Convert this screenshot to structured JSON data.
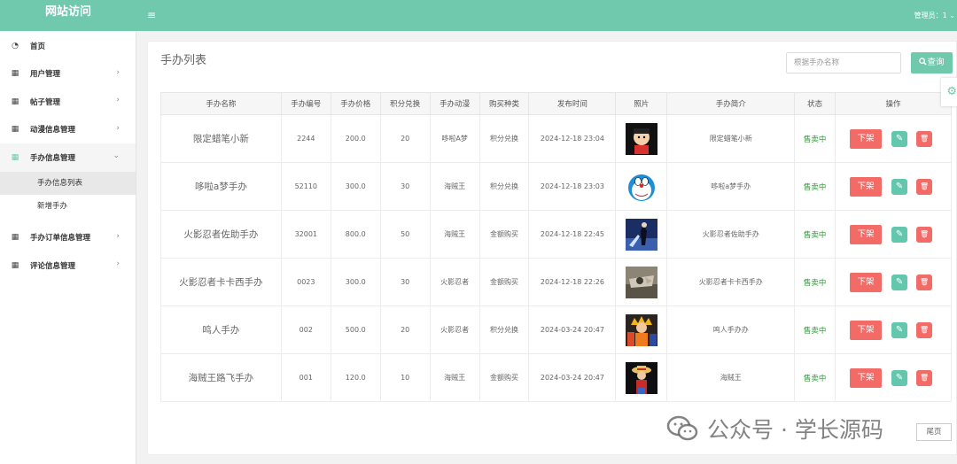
{
  "header": {
    "site_name": "网站访问",
    "menu_icon": "≡",
    "admin_label": "管理员：1 ⌄"
  },
  "sidebar": {
    "items": [
      {
        "name": "nav-home",
        "icon": "dashboard-icon",
        "glyph": "◔",
        "label": "首页",
        "arrow": ""
      },
      {
        "name": "nav-users",
        "icon": "table-icon",
        "glyph": "▦",
        "label": "用户管理",
        "arrow": "›"
      },
      {
        "name": "nav-posts",
        "icon": "table-icon",
        "glyph": "▦",
        "label": "帖子管理",
        "arrow": "›"
      },
      {
        "name": "nav-anime",
        "icon": "table-icon",
        "glyph": "▦",
        "label": "动漫信息管理",
        "arrow": "›"
      },
      {
        "name": "nav-figures",
        "icon": "table-icon",
        "glyph": "▦",
        "label": "手办信息管理",
        "arrow": "⌄"
      }
    ],
    "sub_items": [
      {
        "label": "手办信息列表"
      },
      {
        "label": "新增手办"
      }
    ],
    "items_after": [
      {
        "name": "nav-orders",
        "icon": "table-icon",
        "glyph": "▦",
        "label": "手办订单信息管理",
        "arrow": "›"
      },
      {
        "name": "nav-comments",
        "icon": "table-icon",
        "glyph": "▦",
        "label": "评论信息管理",
        "arrow": "›"
      }
    ]
  },
  "panel": {
    "title": "手办列表",
    "search_placeholder": "根据手办名称",
    "query_label": "查询",
    "query_icon": "search-icon"
  },
  "table": {
    "headers": [
      "手办名称",
      "手办编号",
      "手办价格",
      "积分兑换",
      "手办动漫",
      "购买种类",
      "发布时间",
      "照片",
      "手办简介",
      "状态",
      "操作"
    ],
    "rows": [
      {
        "name": "限定蜡笔小新",
        "code": "2244",
        "price": "200.0",
        "points": "20",
        "anime": "哆啦A梦",
        "type": "积分兑换",
        "date": "2024-12-18 23:04",
        "photo": "crayon-shin-chan",
        "intro": "限定蜡笔小新",
        "status": "售卖中",
        "off_label": "下架"
      },
      {
        "name": "哆啦a梦手办",
        "code": "52110",
        "price": "300.0",
        "points": "30",
        "anime": "海贼王",
        "type": "积分兑换",
        "date": "2024-12-18 23:03",
        "photo": "doraemon",
        "intro": "哆啦a梦手办",
        "status": "售卖中",
        "off_label": "下架"
      },
      {
        "name": "火影忍者佐助手办",
        "code": "32001",
        "price": "800.0",
        "points": "50",
        "anime": "海贼王",
        "type": "金额购买",
        "date": "2024-12-18 22:45",
        "photo": "sasuke",
        "intro": "火影忍者佐助手办",
        "status": "售卖中",
        "off_label": "下架"
      },
      {
        "name": "火影忍者卡卡西手办",
        "code": "0023",
        "price": "300.0",
        "points": "30",
        "anime": "火影忍者",
        "type": "金额购买",
        "date": "2024-12-18 22:26",
        "photo": "kakashi",
        "intro": "火影忍者卡卡西手办",
        "status": "售卖中",
        "off_label": "下架"
      },
      {
        "name": "鸣人手办",
        "code": "002",
        "price": "500.0",
        "points": "20",
        "anime": "火影忍者",
        "type": "积分兑换",
        "date": "2024-03-24 20:47",
        "photo": "naruto",
        "intro": "鸣人手办办",
        "status": "售卖中",
        "off_label": "下架"
      },
      {
        "name": "海贼王路飞手办",
        "code": "001",
        "price": "120.0",
        "points": "10",
        "anime": "海贼王",
        "type": "金额购买",
        "date": "2024-03-24 20:47",
        "photo": "luffy",
        "intro": "海贼王",
        "status": "售卖中",
        "off_label": "下架"
      }
    ]
  },
  "pager": {
    "last_label": "尾页"
  },
  "watermark": {
    "text": "公众号 · 学长源码"
  },
  "colors": {
    "accent": "#70c9ad",
    "danger": "#f36b67",
    "status": "#2d9a33"
  }
}
